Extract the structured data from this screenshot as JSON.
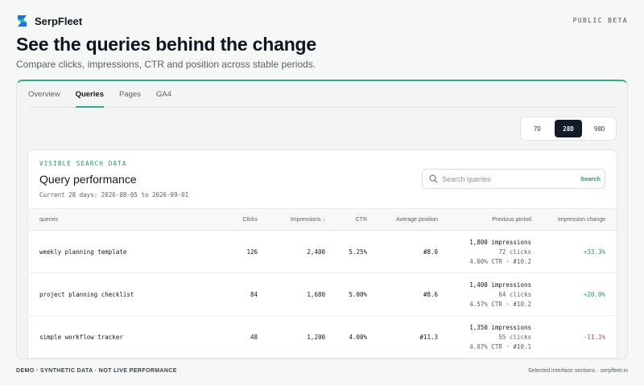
{
  "app": {
    "name": "SerpFleet",
    "badge": "PUBLIC BETA"
  },
  "hero": {
    "title": "See the queries behind the change",
    "subtitle": "Compare clicks, impressions, CTR and position across stable periods."
  },
  "tabs": [
    {
      "label": "Overview",
      "active": false
    },
    {
      "label": "Queries",
      "active": true
    },
    {
      "label": "Pages",
      "active": false
    },
    {
      "label": "GA4",
      "active": false
    }
  ],
  "range_options": [
    {
      "label": "7D",
      "active": false
    },
    {
      "label": "28D",
      "active": true
    },
    {
      "label": "90D",
      "active": false
    }
  ],
  "card": {
    "eyebrow": "VISIBLE SEARCH DATA",
    "title": "Query performance",
    "range_text": "Current 28 days: 2026-08-05 to 2026-09-01",
    "search_placeholder": "Search queries",
    "search_button": "Search"
  },
  "table": {
    "headers": {
      "query": "queries",
      "clicks": "Clicks",
      "impressions": "Impressions ↓",
      "ctr": "CTR",
      "position": "Average position",
      "previous": "Previous period",
      "change": "Impression change"
    },
    "rows": [
      {
        "query": "weekly planning template",
        "clicks": "126",
        "impressions": "2,400",
        "ctr": "5.25%",
        "position": "#8.0",
        "prev_impressions": "1,800 impressions",
        "prev_clicks": "72 clicks",
        "prev_detail": "4.00% CTR · #10.2",
        "change": "+33.3%",
        "trend": "up"
      },
      {
        "query": "project planning checklist",
        "clicks": "84",
        "impressions": "1,680",
        "ctr": "5.00%",
        "position": "#8.6",
        "prev_impressions": "1,400 impressions",
        "prev_clicks": "64 clicks",
        "prev_detail": "4.57% CTR · #10.2",
        "change": "+20.0%",
        "trend": "up"
      },
      {
        "query": "simple workflow tracker",
        "clicks": "48",
        "impressions": "1,200",
        "ctr": "4.00%",
        "position": "#11.3",
        "prev_impressions": "1,350 impressions",
        "prev_clicks": "55 clicks",
        "prev_detail": "4.07% CTR · #10.1",
        "change": "-11.1%",
        "trend": "down"
      }
    ]
  },
  "footer": {
    "left": "DEMO · SYNTHETIC DATA · NOT LIVE PERFORMANCE",
    "right": "Selected interface sections · serpfleet.io"
  },
  "colors": {
    "accent": "#3aa88a",
    "accent_text": "#2f8f73",
    "negative": "#c2453f",
    "dark": "#101c26"
  }
}
